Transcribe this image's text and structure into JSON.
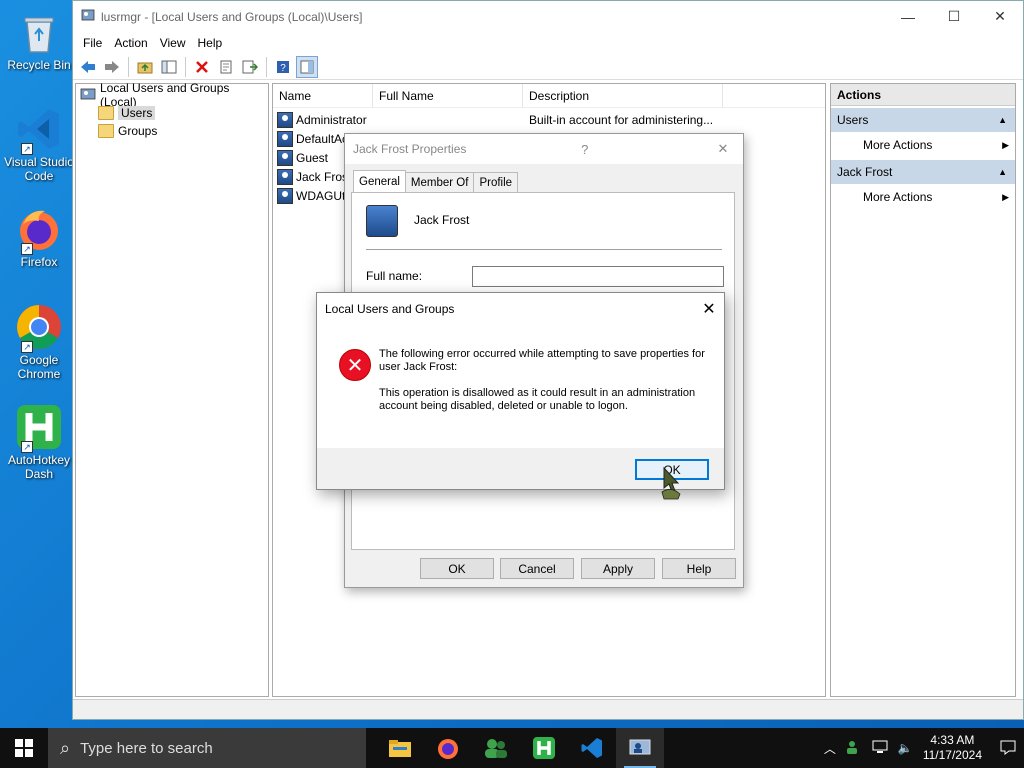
{
  "desktop": {
    "icons": [
      {
        "label": "Recycle Bin"
      },
      {
        "label": "Visual Studio Code"
      },
      {
        "label": "Firefox"
      },
      {
        "label": "Google Chrome"
      },
      {
        "label": "AutoHotkey Dash"
      }
    ]
  },
  "window": {
    "title": "lusrmgr - [Local Users and Groups (Local)\\Users]",
    "menu": [
      "File",
      "Action",
      "View",
      "Help"
    ],
    "tree": {
      "root": "Local Users and Groups (Local)",
      "children": [
        "Users",
        "Groups"
      ]
    },
    "list": {
      "columns": [
        "Name",
        "Full Name",
        "Description"
      ],
      "rows": [
        {
          "name": "Administrator",
          "full_name": "",
          "description": "Built-in account for administering..."
        },
        {
          "name": "DefaultAc",
          "full_name": "",
          "description": ""
        },
        {
          "name": "Guest",
          "full_name": "",
          "description": ""
        },
        {
          "name": "Jack Frost",
          "full_name": "",
          "description": ""
        },
        {
          "name": "WDAGUti",
          "full_name": "",
          "description": ""
        }
      ]
    },
    "actions": {
      "header": "Actions",
      "sections": [
        {
          "title": "Users",
          "items": [
            "More Actions"
          ]
        },
        {
          "title": "Jack Frost",
          "items": [
            "More Actions"
          ]
        }
      ]
    }
  },
  "properties": {
    "title": "Jack Frost Properties",
    "help": "?",
    "tabs": [
      "General",
      "Member Of",
      "Profile"
    ],
    "username": "Jack Frost",
    "full_name_label": "Full name:",
    "full_name_value": "",
    "buttons": [
      "OK",
      "Cancel",
      "Apply",
      "Help"
    ]
  },
  "error": {
    "title": "Local Users and Groups",
    "line1": "The following error occurred while attempting to save properties for user Jack Frost:",
    "line2": "This operation is disallowed as it could result in an administration account being disabled, deleted or unable to logon.",
    "ok": "OK"
  },
  "taskbar": {
    "search_placeholder": "Type here to search",
    "time": "4:33 AM",
    "date": "11/17/2024"
  },
  "colors": {
    "accent": "#0078d7",
    "error": "#e81123",
    "action_section": "#c8d7e8"
  }
}
